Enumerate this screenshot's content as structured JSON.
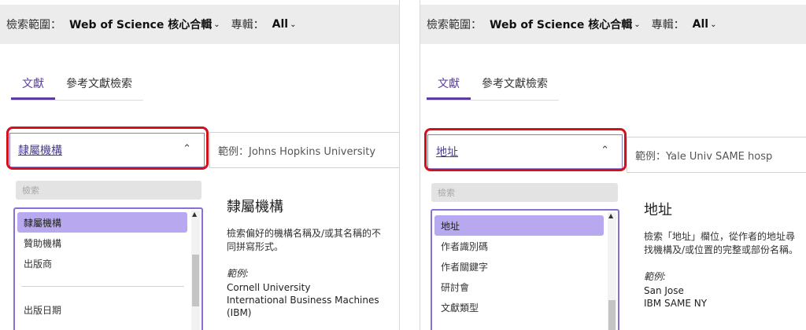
{
  "left": {
    "scope_label": "檢索範圍：",
    "scope_value": "Web of Science 核心合輯",
    "edition_label": "專輯：",
    "edition_value": "All",
    "tabs": [
      "文獻",
      "參考文獻檢索"
    ],
    "field_selected": "隸屬機構",
    "example_text": "範例：Johns Hopkins University",
    "list_search_placeholder": "檢索",
    "list_items": [
      "隸屬機構",
      "贊助機構",
      "出版商"
    ],
    "list_items_after_divider": [
      "出版日期"
    ],
    "desc": {
      "title": "隸屬機構",
      "text": "檢索偏好的機構名稱及/或其名稱的不同拼寫形式。",
      "example_label": "範例:",
      "examples": [
        "Cornell University",
        "International Business Machines",
        "(IBM)"
      ]
    }
  },
  "right": {
    "scope_label": "檢索範圍：",
    "scope_value": "Web of Science 核心合輯",
    "edition_label": "專輯：",
    "edition_value": "All",
    "tabs": [
      "文獻",
      "參考文獻檢索"
    ],
    "field_selected": "地址",
    "example_text": "範例：Yale Univ SAME hosp",
    "list_search_placeholder": "檢索",
    "list_items": [
      "地址",
      "作者識別碼",
      "作者關鍵字",
      "研討會",
      "文獻類型"
    ],
    "desc": {
      "title": "地址",
      "text": "檢索「地址」欄位，從作者的地址尋找機構及/或位置的完整或部份名稱。",
      "example_label": "範例:",
      "examples": [
        "San Jose",
        "IBM SAME NY"
      ]
    }
  },
  "icons": {
    "chevron": "chevron-down-icon",
    "caret_up": "chevron-up-icon"
  },
  "colors": {
    "accent": "#5b3fa0",
    "highlight": "#d3101b",
    "selected_item": "#b7a8ef"
  }
}
